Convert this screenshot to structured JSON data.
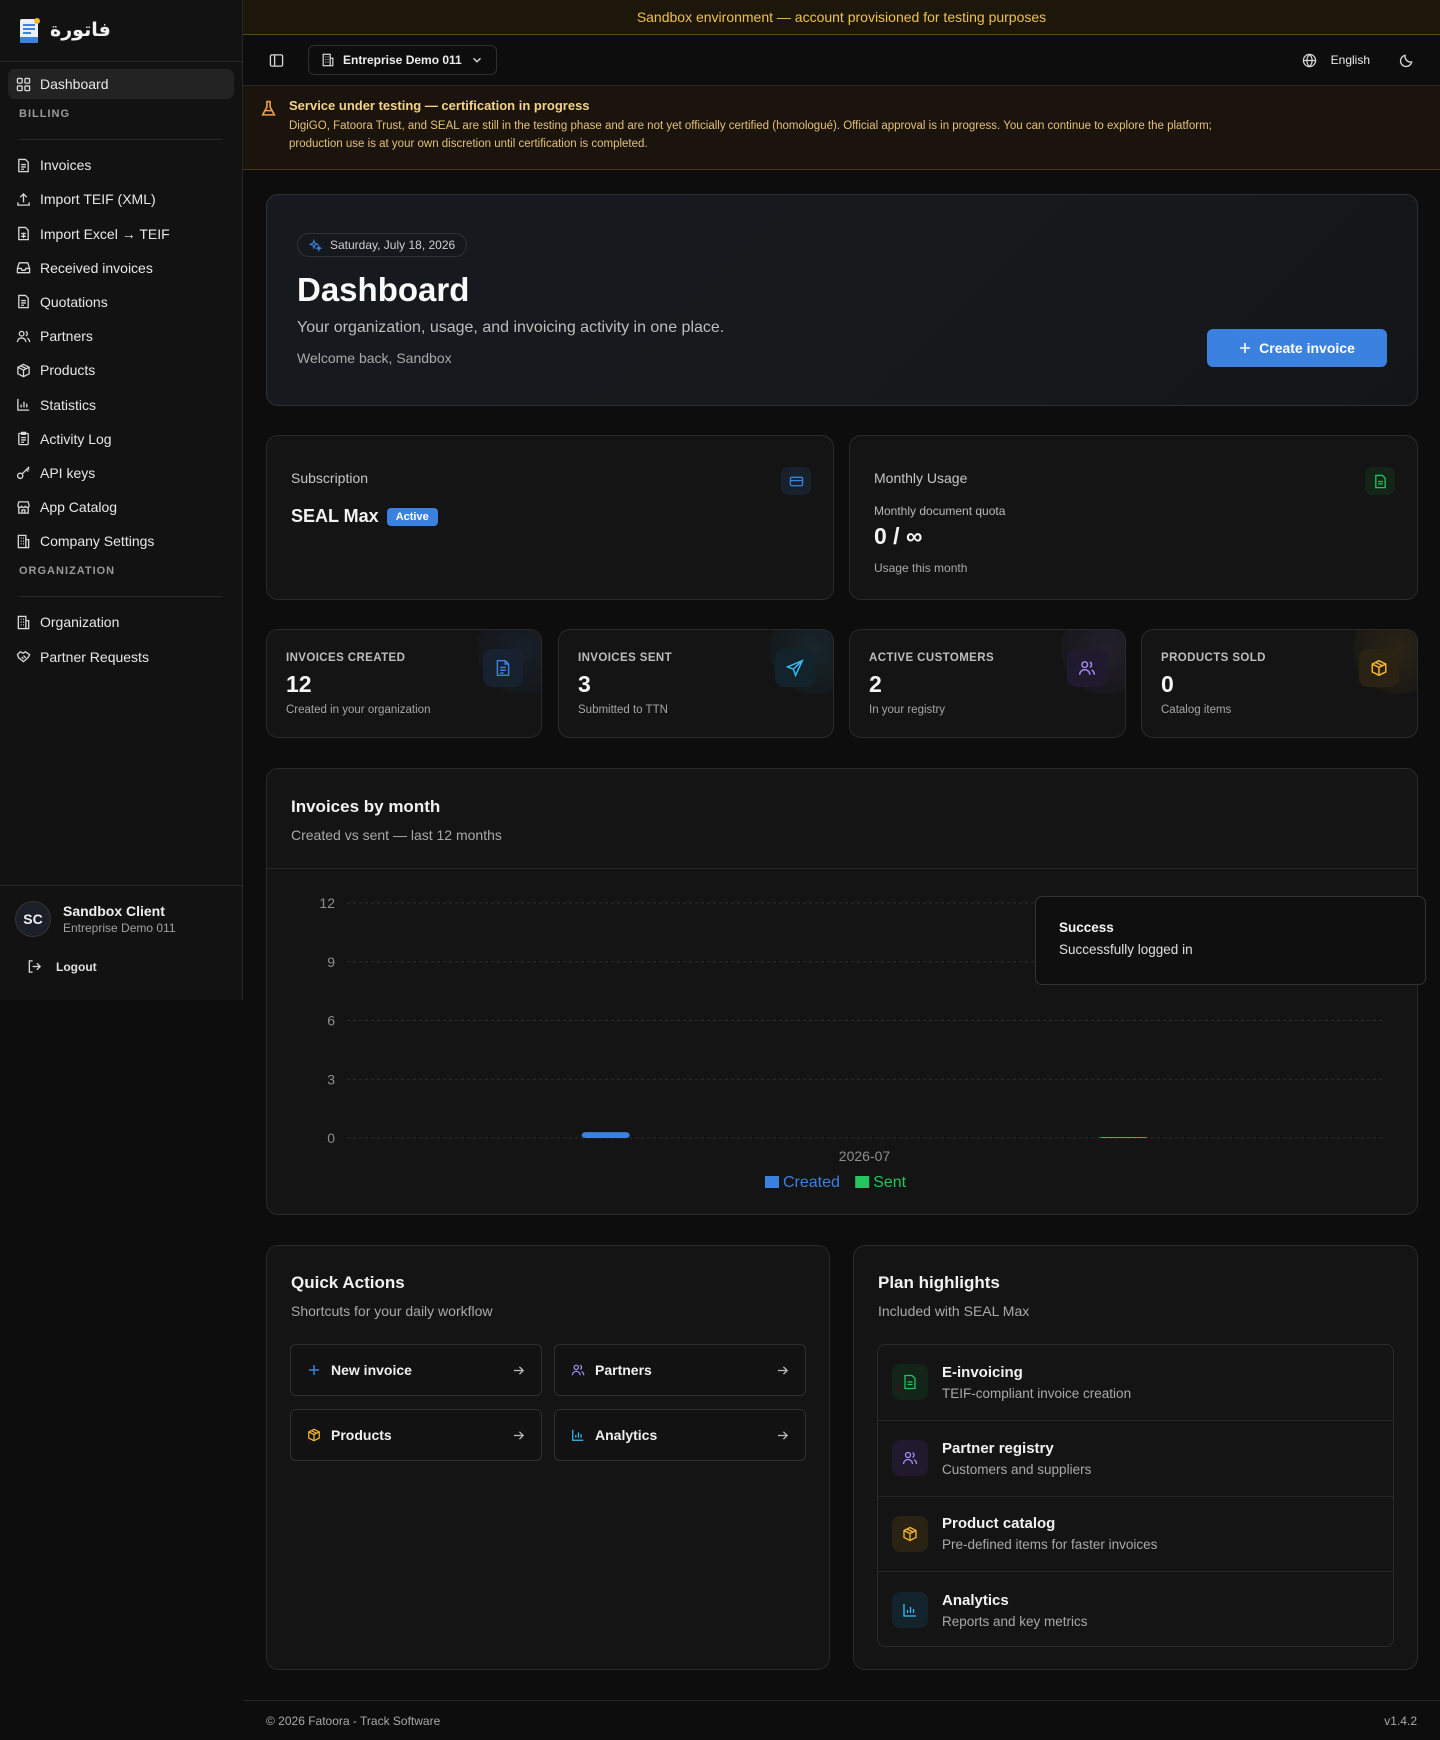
{
  "brand": {
    "name": "فاتورة"
  },
  "sidebar": {
    "dashboard": "Dashboard",
    "billing_label": "BILLING",
    "billing_items": [
      "Invoices",
      "Import TEIF (XML)",
      "Import Excel → TEIF",
      "Received invoices",
      "Quotations",
      "Partners",
      "Products",
      "Statistics",
      "Activity Log",
      "API keys",
      "App Catalog",
      "Company Settings"
    ],
    "org_label": "ORGANIZATION",
    "org_items": [
      "Organization",
      "Partner Requests"
    ],
    "user": {
      "initials": "SC",
      "name": "Sandbox Client",
      "org": "Entreprise Demo 011"
    },
    "logout": "Logout"
  },
  "sandbox_banner": "Sandbox environment — account provisioned for testing purposes",
  "topbar": {
    "org": "Entreprise Demo 011",
    "language": "English"
  },
  "warning": {
    "title": "Service under testing — certification in progress",
    "text": "DigiGO, Fatoora Trust, and SEAL are still in the testing phase and are not yet officially certified (homologué). Official approval is in progress. You can continue to explore the platform; production use is at your own discretion until certification is completed."
  },
  "hero": {
    "date": "Saturday, July 18, 2026",
    "title": "Dashboard",
    "subtitle": "Your organization, usage, and invoicing activity in one place.",
    "welcome": "Welcome back, Sandbox",
    "create_button": "Create invoice"
  },
  "subscription": {
    "label": "Subscription",
    "plan": "SEAL Max",
    "status": "Active"
  },
  "usage": {
    "label": "Monthly Usage",
    "quota_label": "Monthly document quota",
    "quota_value": "0 / ∞",
    "sub": "Usage this month"
  },
  "stats": [
    {
      "label": "INVOICES CREATED",
      "value": "12",
      "sub": "Created in your organization",
      "color": "#3b82e0"
    },
    {
      "label": "INVOICES SENT",
      "value": "3",
      "sub": "Submitted to TTN",
      "color": "#38bdf8"
    },
    {
      "label": "ACTIVE CUSTOMERS",
      "value": "2",
      "sub": "In your registry",
      "color": "#a78bfa"
    },
    {
      "label": "PRODUCTS SOLD",
      "value": "0",
      "sub": "Catalog items",
      "color": "#f5b82e"
    }
  ],
  "chart": {
    "title": "Invoices by month",
    "subtitle": "Created vs sent — last 12 months"
  },
  "chart_data": {
    "type": "bar",
    "categories": [
      "2026-07"
    ],
    "series": [
      {
        "name": "Created",
        "values": [
          0.3
        ],
        "color": "#3b82e0"
      },
      {
        "name": "Sent",
        "values": [
          0.05
        ],
        "color": "#22c55e"
      }
    ],
    "yticks": [
      0,
      3,
      6,
      9,
      12
    ],
    "ylim": [
      0,
      12
    ],
    "grid": true,
    "legend": "bottom"
  },
  "toast": {
    "title": "Success",
    "message": "Successfully logged in"
  },
  "quick_actions": {
    "title": "Quick Actions",
    "subtitle": "Shortcuts for your daily workflow",
    "items": [
      "New invoice",
      "Partners",
      "Products",
      "Analytics"
    ]
  },
  "plan_highlights": {
    "title": "Plan highlights",
    "subtitle": "Included with SEAL Max",
    "items": [
      {
        "title": "E-invoicing",
        "desc": "TEIF-compliant invoice creation"
      },
      {
        "title": "Partner registry",
        "desc": "Customers and suppliers"
      },
      {
        "title": "Product catalog",
        "desc": "Pre-defined items for faster invoices"
      },
      {
        "title": "Analytics",
        "desc": "Reports and key metrics"
      }
    ]
  },
  "footer": {
    "copyright": "© 2026 Fatoora - Track Software",
    "version": "v1.4.2"
  }
}
